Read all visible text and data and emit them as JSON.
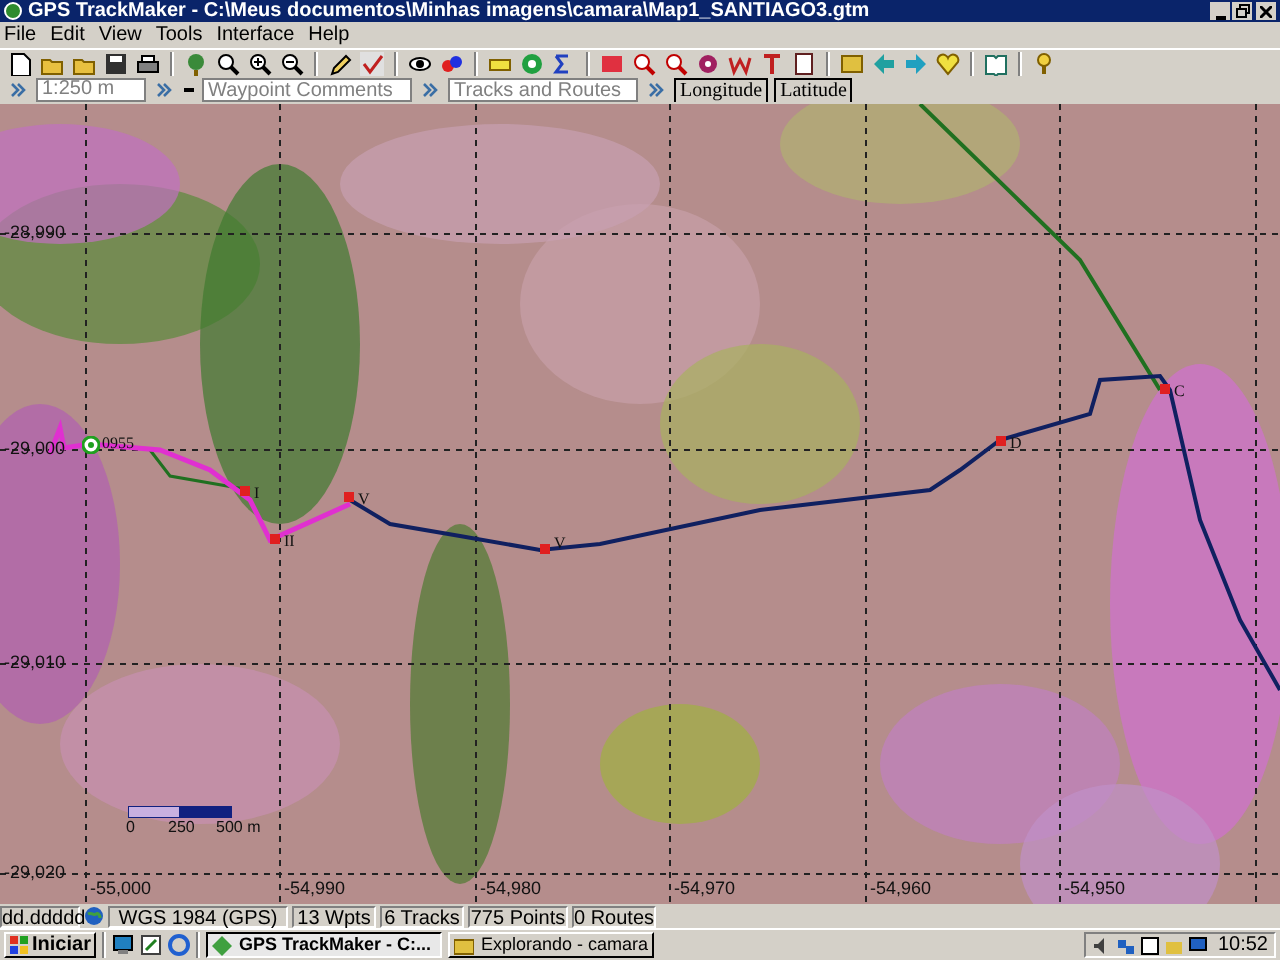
{
  "window": {
    "title": "GPS TrackMaker - C:\\Meus documentos\\Minhas imagens\\camara\\Map1_SANTIAGO3.gtm"
  },
  "menu": [
    "File",
    "Edit",
    "View",
    "Tools",
    "Interface",
    "Help"
  ],
  "toolbar2": {
    "scale": "1:250 m",
    "waypoint_field": {
      "placeholder": "Waypoint Comments"
    },
    "track_field": {
      "placeholder": "Tracks and Routes"
    },
    "coordinate_labels": [
      "Longitude",
      "Latitude"
    ]
  },
  "map": {
    "y_labels": [
      "-28,990",
      "-29,000",
      "-29,010",
      "-29,020"
    ],
    "x_labels": [
      "-55,000",
      "-54,990",
      "-54,980",
      "-54,970",
      "-54,960",
      "-54,950"
    ],
    "waypoints": [
      {
        "label": "0955"
      },
      {
        "label": "I"
      },
      {
        "label": "II"
      },
      {
        "label": "V"
      },
      {
        "label": "V"
      },
      {
        "label": "D"
      },
      {
        "label": "C"
      }
    ],
    "scale_labels": [
      "0",
      "250",
      "500 m"
    ]
  },
  "status_bar": [
    "dd.ddddd",
    "WGS 1984 (GPS)",
    "13 Wpts",
    "6 Tracks",
    "775 Points",
    "0 Routes"
  ],
  "taskbar": {
    "start": "Iniciar",
    "tasks": [
      {
        "label": "GPS TrackMaker - C:...",
        "selected": true
      },
      {
        "label": "Explorando - camara",
        "selected": false
      }
    ],
    "clock": "10:52"
  }
}
